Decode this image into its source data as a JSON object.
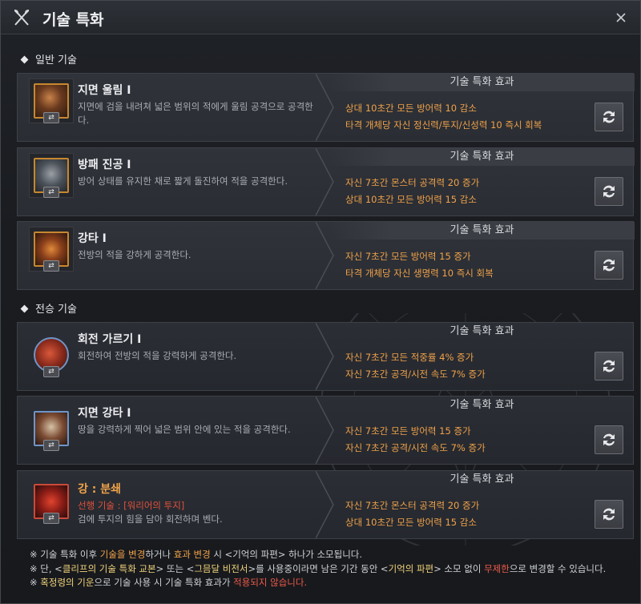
{
  "window": {
    "title": "기술 특화",
    "title_icon": "crossed-axes-icon",
    "close_icon": "close-icon"
  },
  "sections": {
    "general": "일반 기술",
    "inherited": "전승 기술"
  },
  "effect_header": "기술 특화 효과",
  "change_button_icon": "swap-arrows-icon",
  "skills": [
    {
      "name": "지면 울림 I",
      "desc": "지면에 검을 내려쳐 넓은 범위의 적에게 울림 공격으로 공격한다.",
      "effects": [
        "상대 10초간 모든 방어력 10 감소",
        "타격 개체당 자신 정신력/투지/신성력 10 즉시 회복"
      ]
    },
    {
      "name": "방패 진공 I",
      "desc": "방어 상태를 유지한 채로 짧게 돌진하여 적을 공격한다.",
      "effects": [
        "자신 7초간 몬스터 공격력 20 증가",
        "상대 10초간 모든 방어력 15 감소"
      ]
    },
    {
      "name": "강타 I",
      "desc": "전방의 적을 강하게 공격한다.",
      "effects": [
        "자신 7초간 모든 방어력 15 증가",
        "타격 개체당 자신 생명력 10 즉시 회복"
      ]
    },
    {
      "name": "회전 가르기 I",
      "desc": "회전하여 전방의 적을 강력하게 공격한다.",
      "effects": [
        "자신 7초간 모든 적중률 4% 증가",
        "자신 7초간 공격/시전 속도 7% 증가"
      ]
    },
    {
      "name": "지면 강타 I",
      "desc": "땅을 강력하게 찍어 넓은 범위 안에 있는 적을 공격한다.",
      "effects": [
        "자신 7초간 모든 방어력 15 증가",
        "자신 7초간 공격/시전 속도 7% 증가"
      ]
    },
    {
      "name": "강 : 분쇄",
      "pre_label": "선행 기술 : ",
      "pre_value": "[워리어의 투지]",
      "desc": "검에 투지의 힘을 담아 회전하며 벤다.",
      "effects": [
        "자신 7초간 몬스터 공격력 20 증가",
        "상대 10초간 모든 방어력 15 감소"
      ]
    }
  ],
  "notes": {
    "n1_a": "※ 기술 특화 이후 ",
    "n1_b": "기술을 변경",
    "n1_c": "하거나 ",
    "n1_d": "효과 변경",
    "n1_e": " 시 <기억의 파편> 하나가 소모됩니다.",
    "n2_a": "※ 단, <",
    "n2_b": "클리프의 기술 특화 교본",
    "n2_c": "> 또는 <",
    "n2_d": "그믐달 비전서",
    "n2_e": ">를 사용중이라면 남은 기간 동안 <",
    "n2_f": "기억의 파편",
    "n2_g": "> 소모 없이 ",
    "n2_h": "무제한",
    "n2_i": "으로 변경할 수 있습니다.",
    "n3_a": "※ ",
    "n3_b": "혹정령의 기운",
    "n3_c": "으로 기술 사용 시 기술 특화 효과가 ",
    "n3_d": "적용되지 않습니다."
  }
}
